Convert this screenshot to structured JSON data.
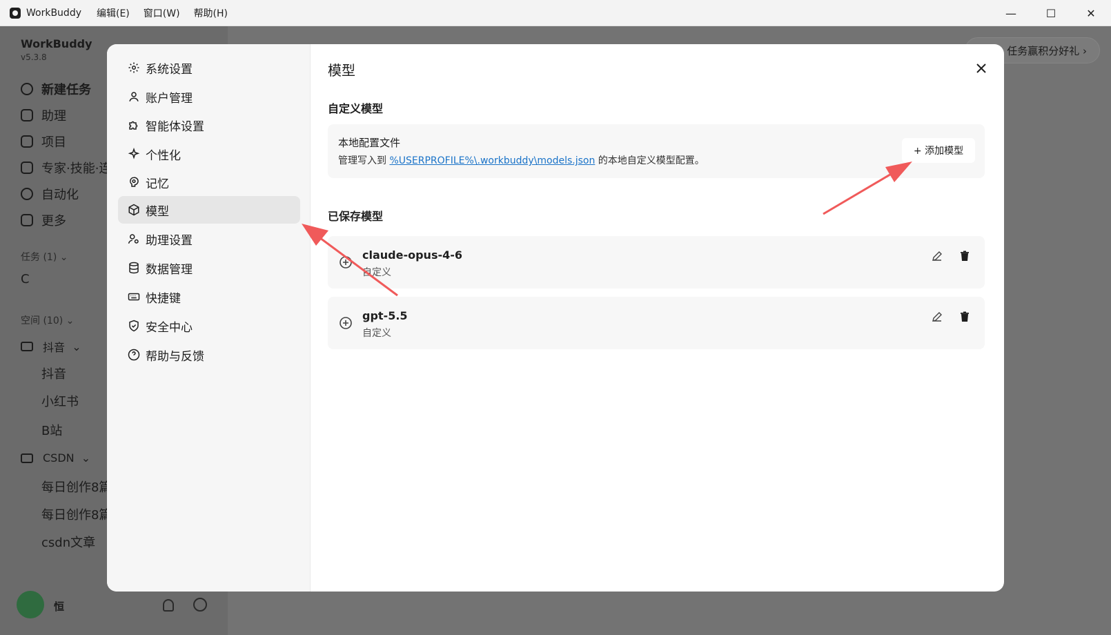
{
  "titlebar": {
    "app_title": "WorkBuddy",
    "menu": [
      "编辑(E)",
      "窗口(W)",
      "帮助(H)"
    ],
    "minimize": "—",
    "maximize": "☐",
    "close": "✕"
  },
  "background_app": {
    "brand": "WorkBuddy",
    "version": "v5.3.8",
    "nav": [
      "新建任务",
      "助理",
      "项目",
      "专家·技能·连",
      "自动化",
      "更多"
    ],
    "tasks_section": "任务 (1)",
    "task_item": "C",
    "spaces_section": "空间 (10)",
    "folder_1": "抖音",
    "folder_1_children": [
      "抖音",
      "小红书",
      "B站"
    ],
    "folder_2": "CSDN",
    "folder_2_children": [
      "每日创作8篇",
      "每日创作8篇",
      "csdn文章"
    ],
    "user_name": "恒",
    "promo": "任务赢积分好礼 ›"
  },
  "settings_nav": [
    {
      "label": "系统设置",
      "icon": "gear-icon"
    },
    {
      "label": "账户管理",
      "icon": "user-icon"
    },
    {
      "label": "智能体设置",
      "icon": "puzzle-icon"
    },
    {
      "label": "个性化",
      "icon": "sparkle-icon"
    },
    {
      "label": "记忆",
      "icon": "brain-icon"
    },
    {
      "label": "模型",
      "icon": "cube-icon"
    },
    {
      "label": "助理设置",
      "icon": "user-gear-icon"
    },
    {
      "label": "数据管理",
      "icon": "database-icon"
    },
    {
      "label": "快捷键",
      "icon": "keyboard-icon"
    },
    {
      "label": "安全中心",
      "icon": "shield-icon"
    },
    {
      "label": "帮助与反馈",
      "icon": "help-icon"
    }
  ],
  "content": {
    "page_title": "模型",
    "custom_section": "自定义模型",
    "config_title": "本地配置文件",
    "config_desc_prefix": "管理写入到 ",
    "config_path": "%USERPROFILE%\\.workbuddy\\models.json",
    "config_desc_suffix": " 的本地自定义模型配置。",
    "add_button": "+ 添加模型",
    "saved_section": "已保存模型",
    "models": [
      {
        "name": "claude-opus-4-6",
        "tag": "自定义"
      },
      {
        "name": "gpt-5.5",
        "tag": "自定义"
      }
    ]
  },
  "colors": {
    "accent_link": "#1a73c8",
    "annotation_arrow": "#f05a5a",
    "active_nav_bg": "#e6e6e6"
  }
}
